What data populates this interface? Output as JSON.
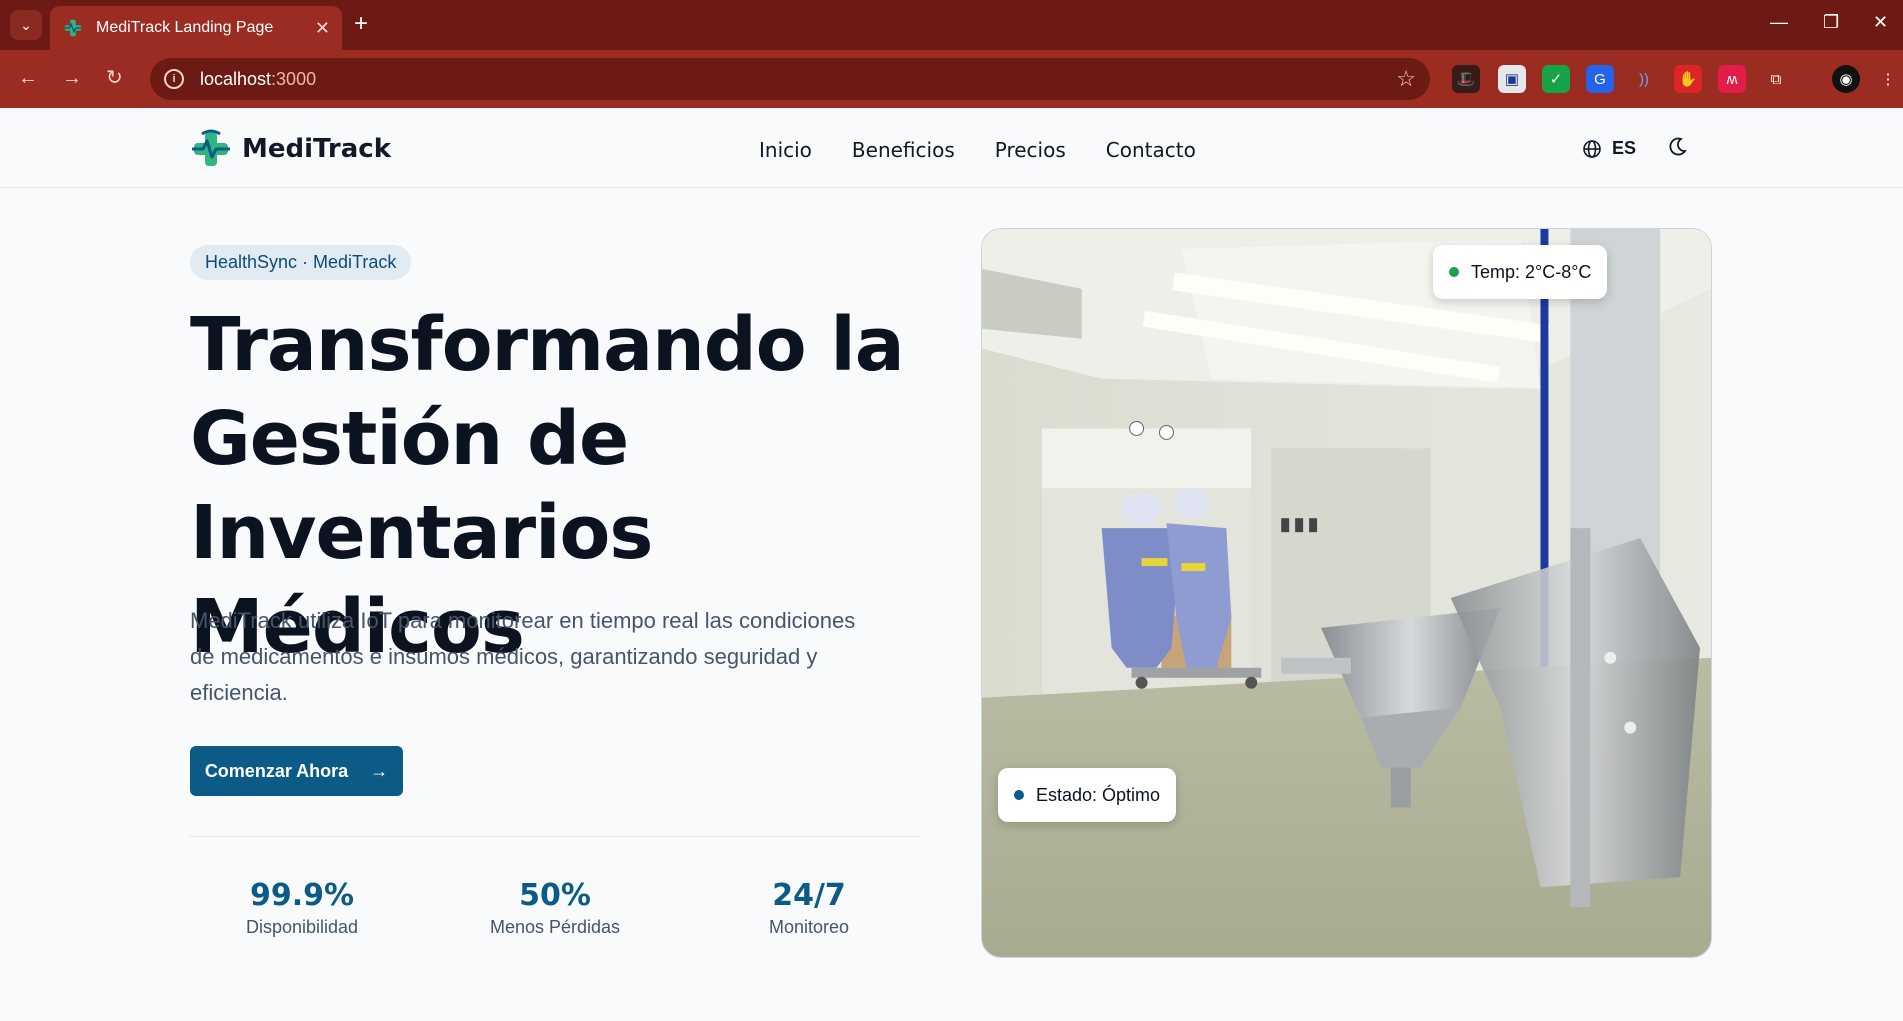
{
  "browser": {
    "tab_title": "MediTrack Landing Page",
    "url_host": "localhost",
    "url_port": ":3000"
  },
  "nav": {
    "brand": "MediTrack",
    "links": [
      "Inicio",
      "Beneficios",
      "Precios",
      "Contacto"
    ],
    "language": "ES"
  },
  "hero": {
    "badge": "HealthSync · MediTrack",
    "title_line1": "Transformando la",
    "title_line2": "Gestión de",
    "title_line3": "Inventarios Médicos",
    "description": "MediTrack utiliza IoT para monitorear en tiempo real las condiciones de medicamentos e insumos médicos, garantizando seguridad y eficiencia.",
    "cta_label": "Comenzar Ahora",
    "temp_label": "Temp: 2°C-8°C",
    "status_label": "Estado: Óptimo"
  },
  "stats": [
    {
      "value": "99.9%",
      "label": "Disponibilidad"
    },
    {
      "value": "50%",
      "label": "Menos Pérdidas"
    },
    {
      "value": "24/7",
      "label": "Monitoreo"
    }
  ],
  "colors": {
    "accent": "#0b5b86",
    "browser_frame": "#9b2c22",
    "temp_dot": "#16a34a",
    "status_dot": "#0b5b86"
  }
}
